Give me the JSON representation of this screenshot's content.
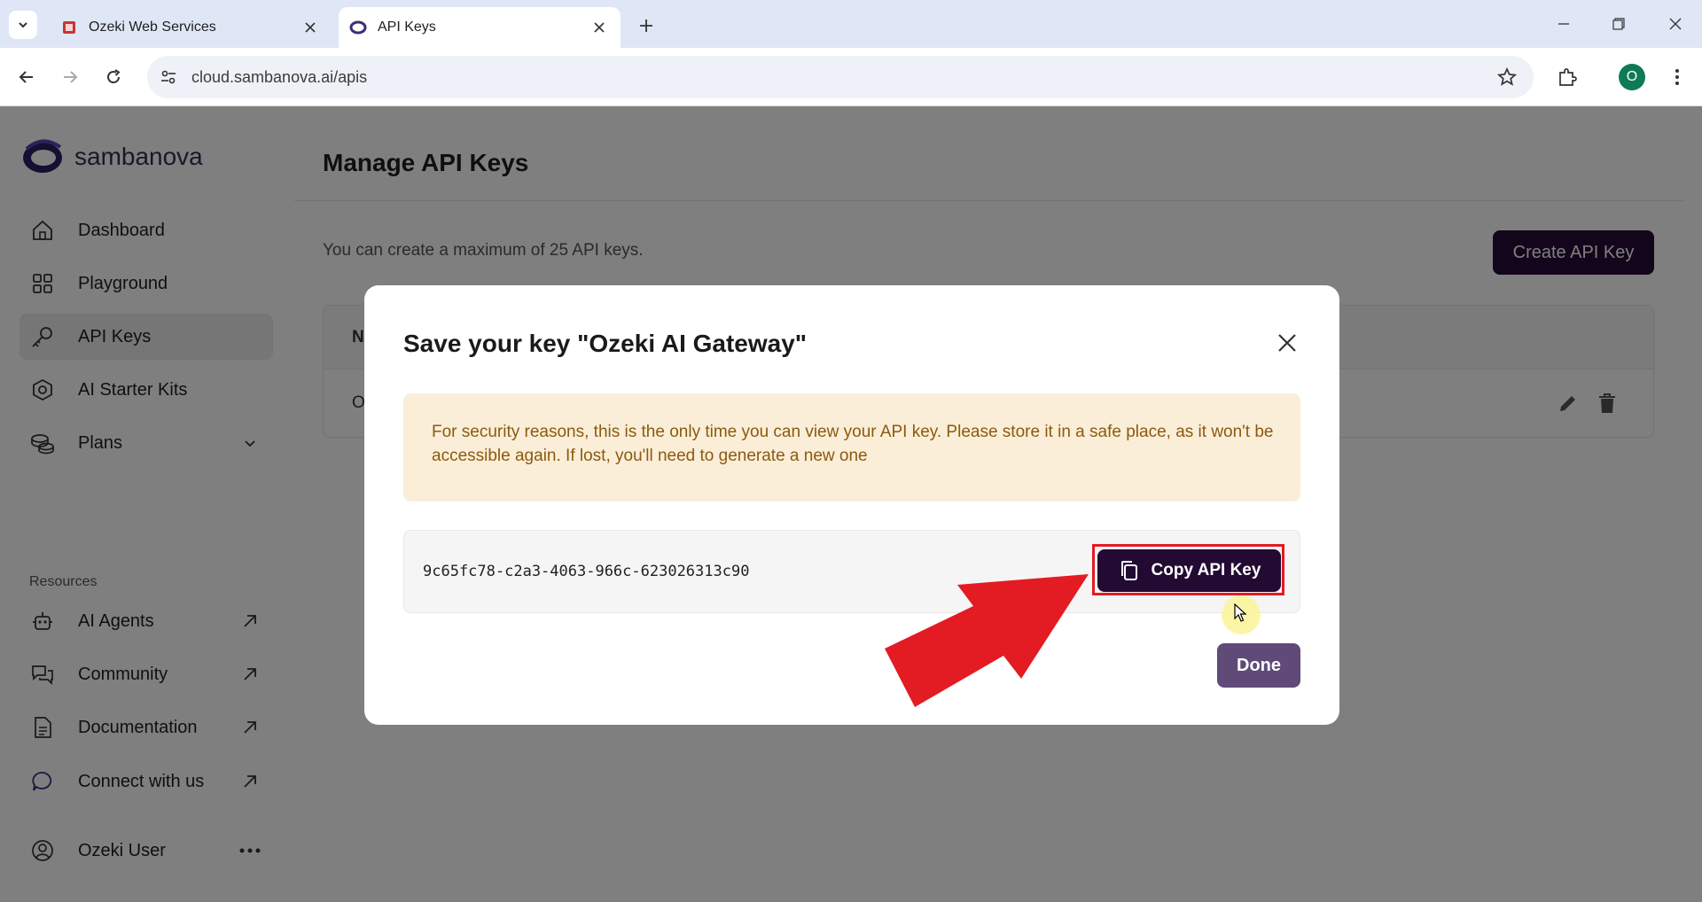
{
  "browser": {
    "tabs": [
      {
        "title": "Ozeki Web Services",
        "active": false,
        "icon": "ozeki-favicon"
      },
      {
        "title": "API Keys",
        "active": true,
        "icon": "sambanova-favicon"
      }
    ],
    "url": "cloud.sambanova.ai/apis",
    "profile_initial": "O"
  },
  "sidebar": {
    "brand": "sambanova",
    "items": [
      {
        "label": "Dashboard",
        "icon": "home-icon"
      },
      {
        "label": "Playground",
        "icon": "grid-icon"
      },
      {
        "label": "API Keys",
        "icon": "key-icon",
        "selected": true
      },
      {
        "label": "AI Starter Kits",
        "icon": "hexagon-icon"
      },
      {
        "label": "Plans",
        "icon": "coins-icon"
      }
    ],
    "resources_label": "Resources",
    "resources": [
      {
        "label": "AI Agents",
        "icon": "robot-icon"
      },
      {
        "label": "Community",
        "icon": "chat-icon"
      },
      {
        "label": "Documentation",
        "icon": "document-icon"
      },
      {
        "label": "Connect with us",
        "icon": "discord-icon"
      }
    ],
    "user": {
      "name": "Ozeki User"
    }
  },
  "main": {
    "title": "Manage API Keys",
    "helper": "You can create a maximum of 25 API keys.",
    "create_button": "Create API Key",
    "table_header_partial": "N",
    "table_row_partial": "O"
  },
  "modal": {
    "title": "Save your key \"Ozeki AI Gateway\"",
    "warning": "For security reasons, this is the only time you can view your API key. Please store it in a safe place, as it won't be accessible again. If lost, you'll need to generate a new one",
    "api_key": "9c65fc78-c2a3-4063-966c-623026313c90",
    "copy_button": "Copy API Key",
    "done_button": "Done"
  },
  "colors": {
    "brand_dark": "#260b36",
    "done_button": "#5f4a78",
    "warning_bg": "#fbeed8",
    "warning_text": "#8a5a10",
    "annotation_red": "#e31b23"
  }
}
